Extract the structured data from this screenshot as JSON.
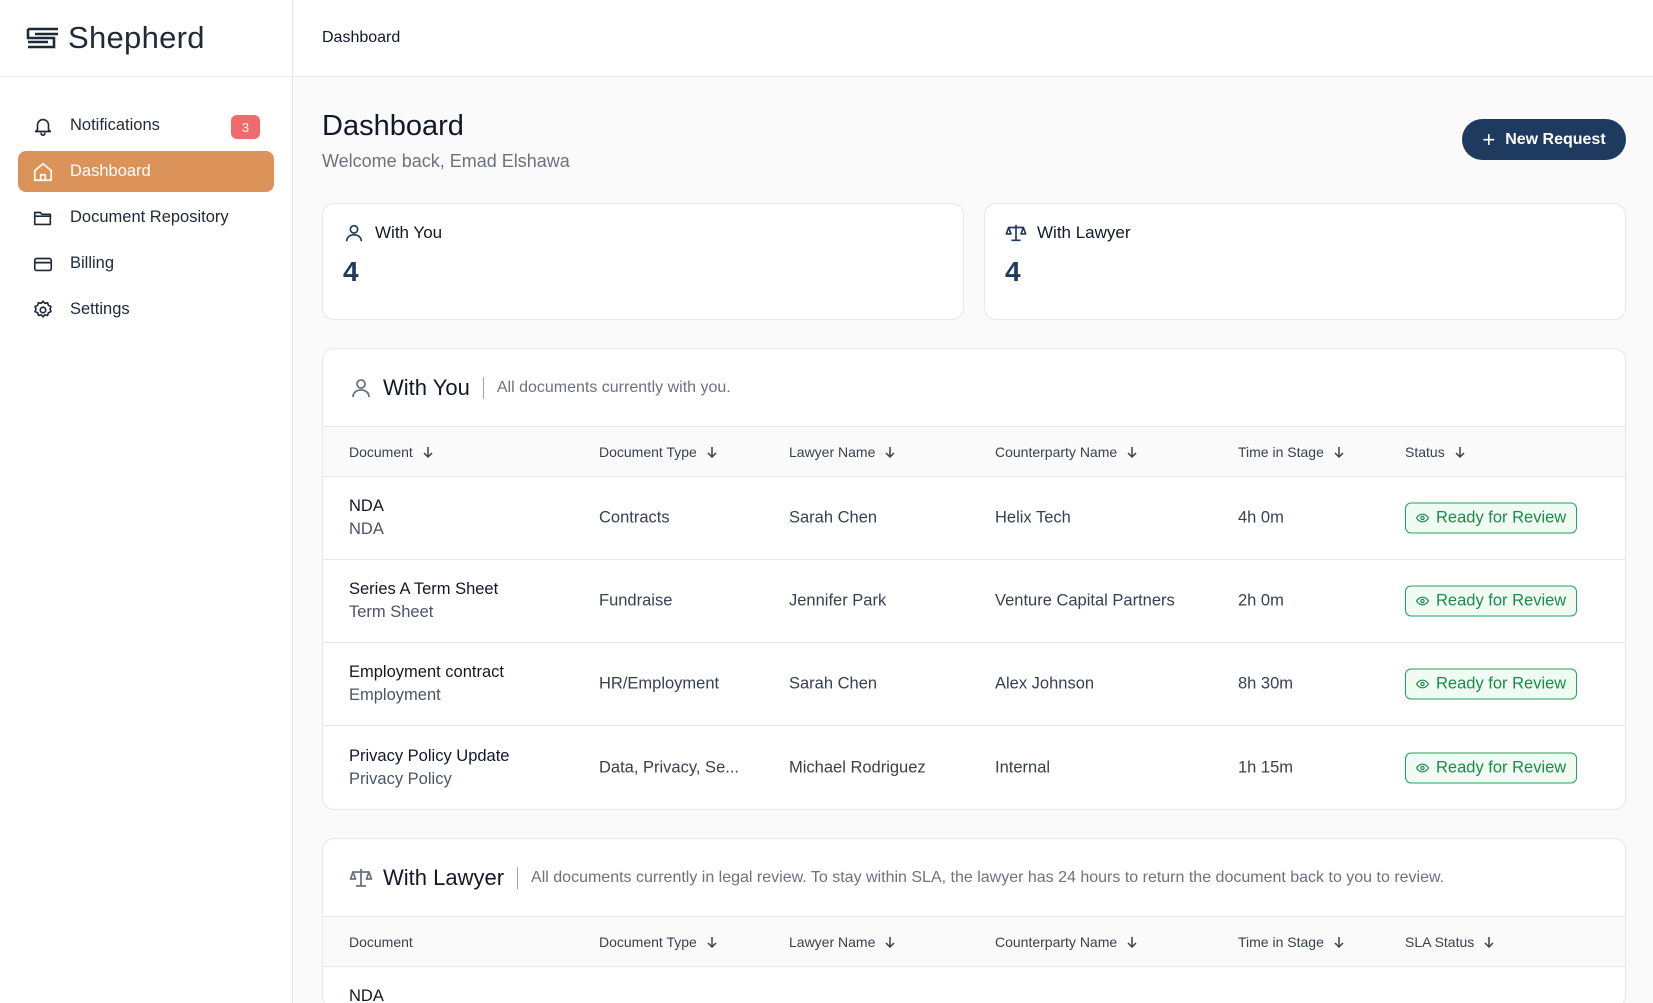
{
  "brand": {
    "name": "Shepherd"
  },
  "sidebar": {
    "items": [
      {
        "label": "Notifications",
        "icon": "bell-icon",
        "badge": "3"
      },
      {
        "label": "Dashboard",
        "icon": "home-icon",
        "active": true
      },
      {
        "label": "Document Repository",
        "icon": "folder-icon"
      },
      {
        "label": "Billing",
        "icon": "credit-card-icon"
      },
      {
        "label": "Settings",
        "icon": "gear-icon"
      }
    ]
  },
  "topbar": {
    "title": "Dashboard"
  },
  "header": {
    "title": "Dashboard",
    "subtitle": "Welcome back, Emad Elshawa",
    "new_request_label": "New Request"
  },
  "cards": [
    {
      "label": "With You",
      "value": "4",
      "icon": "user-icon"
    },
    {
      "label": "With Lawyer",
      "value": "4",
      "icon": "scale-icon"
    }
  ],
  "with_you": {
    "title": "With You",
    "description": "All documents currently with you.",
    "columns": [
      "Document",
      "Document Type",
      "Lawyer Name",
      "Counterparty Name",
      "Time in Stage",
      "Status"
    ],
    "rows": [
      {
        "name": "NDA",
        "subtype": "NDA",
        "type": "Contracts",
        "lawyer": "Sarah Chen",
        "counterparty": "Helix Tech",
        "time": "4h 0m",
        "status": "Ready for Review"
      },
      {
        "name": "Series A Term Sheet",
        "subtype": "Term Sheet",
        "type": "Fundraise",
        "lawyer": "Jennifer Park",
        "counterparty": "Venture Capital Partners",
        "time": "2h 0m",
        "status": "Ready for Review"
      },
      {
        "name": "Employment contract",
        "subtype": "Employment",
        "type": "HR/Employment",
        "lawyer": "Sarah Chen",
        "counterparty": "Alex Johnson",
        "time": "8h 30m",
        "status": "Ready for Review"
      },
      {
        "name": "Privacy Policy Update",
        "subtype": "Privacy Policy",
        "type": "Data, Privacy, Se...",
        "lawyer": "Michael Rodriguez",
        "counterparty": "Internal",
        "time": "1h 15m",
        "status": "Ready for Review"
      }
    ]
  },
  "with_lawyer": {
    "title": "With Lawyer",
    "description": "All documents currently in legal review. To stay within SLA, the lawyer has 24 hours to return the document back to you to review.",
    "columns": [
      "Document",
      "Document Type",
      "Lawyer Name",
      "Counterparty Name",
      "Time in Stage",
      "SLA Status"
    ],
    "rows": [
      {
        "name": "NDA"
      }
    ]
  },
  "colors": {
    "accent": "#dc935a",
    "primary": "#1f3a5f",
    "status_green": "#22a35a",
    "badge_red": "#f06b6b"
  }
}
